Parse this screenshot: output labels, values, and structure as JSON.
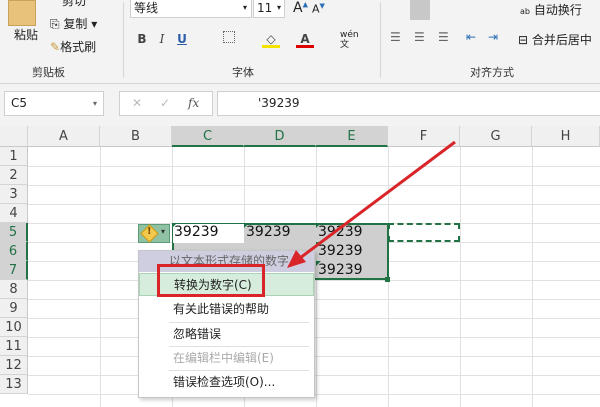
{
  "ribbon": {
    "paste": "粘贴",
    "cut": "剪切",
    "copy": "复制",
    "format_painter": "格式刷",
    "clipboard_label": "剪贴板",
    "font_name": "等线",
    "font_size": "11",
    "bold": "B",
    "italic": "I",
    "underline": "U",
    "phonetic": "wén文",
    "font_label": "字体",
    "wrap_text": "自动换行",
    "merge_center": "合并后居中",
    "alignment_label": "对齐方式"
  },
  "formula_bar": {
    "name_box": "C5",
    "fx": "fx",
    "value": "'39239"
  },
  "columns": [
    "A",
    "B",
    "C",
    "D",
    "E",
    "F",
    "G",
    "H"
  ],
  "rows": [
    "1",
    "2",
    "3",
    "4",
    "5",
    "6",
    "7",
    "8",
    "9",
    "10",
    "11",
    "12",
    "13"
  ],
  "cells": {
    "C5": "39239",
    "D5": "39239",
    "E5": "39239",
    "E6": "39239",
    "E7": "39239"
  },
  "menu": {
    "header": "以文本形式存储的数字",
    "items": [
      {
        "label": "转换为数字(C)",
        "highlighted": true
      },
      {
        "label": "有关此错误的帮助"
      },
      {
        "label": "忽略错误"
      },
      {
        "label": "在编辑栏中编辑(E)",
        "disabled": true
      },
      {
        "label": "错误检查选项(O)..."
      }
    ]
  },
  "colors": {
    "accent": "#217346",
    "annotation": "#d9252a"
  }
}
